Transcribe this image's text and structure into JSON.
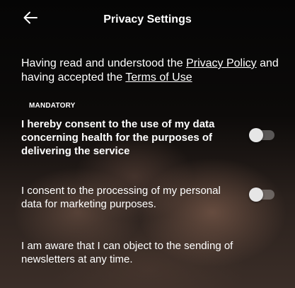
{
  "header": {
    "title": "Privacy Settings"
  },
  "intro": {
    "text_before": "Having read and understood the ",
    "privacy_policy_link": "Privacy Policy",
    "text_middle": " and having accepted the ",
    "terms_link": "Terms of Use"
  },
  "consents": {
    "mandatory_label": "MANDATORY",
    "health_data": {
      "text": "I hereby consent to the use of my data concerning health for the purposes of delivering the service",
      "enabled": false
    },
    "marketing": {
      "text": "I consent to the processing of my personal data for marketing purposes.",
      "enabled": false
    },
    "newsletter_notice": "I am aware that I can object to the sending of newsletters at any time."
  },
  "colors": {
    "text": "#ffffff",
    "toggle_knob": "#e6e6e6"
  }
}
